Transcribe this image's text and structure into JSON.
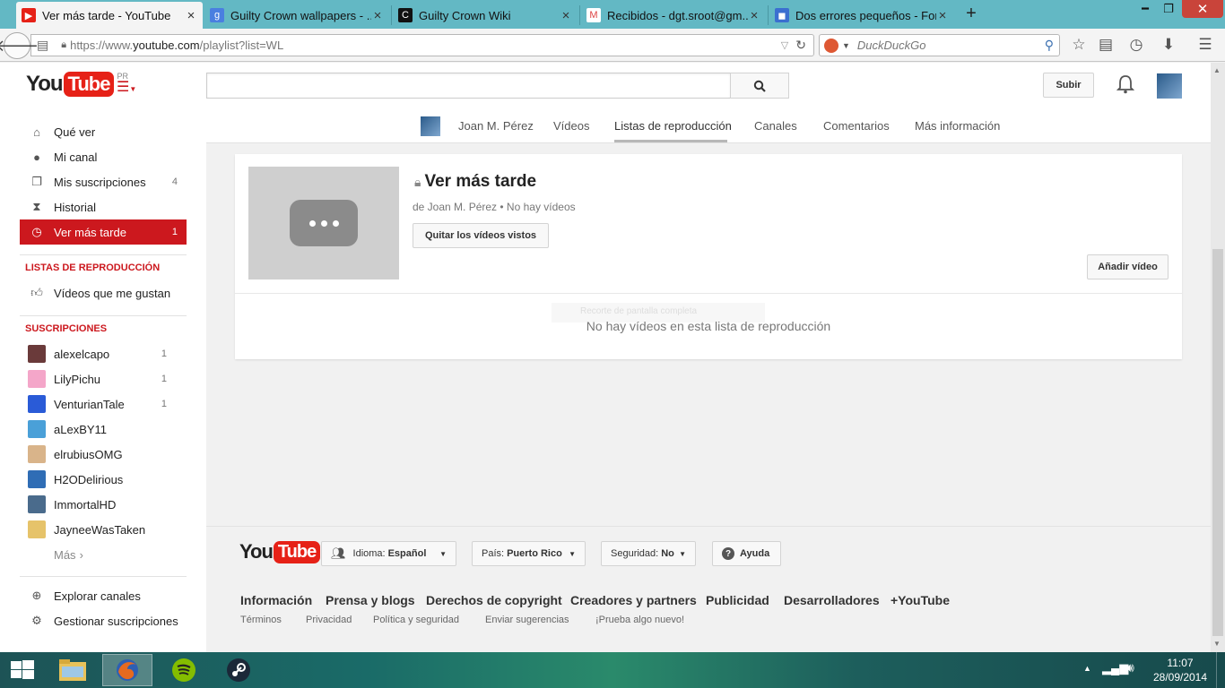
{
  "browser": {
    "tabs": [
      {
        "title": "Ver más tarde - YouTube",
        "active": true
      },
      {
        "title": "Guilty Crown wallpapers - ...",
        "active": false
      },
      {
        "title": "Guilty Crown Wiki",
        "active": false
      },
      {
        "title": "Recibidos - dgt.sroot@gm...",
        "active": false
      },
      {
        "title": "Dos errores pequeños - For...",
        "active": false
      }
    ],
    "new_tab": "+",
    "url_prefix": "https://www.",
    "url_domain": "youtube.com",
    "url_path": "/playlist?list=WL",
    "search_engine": "DuckDuckGo"
  },
  "youtube": {
    "logo_you": "You",
    "logo_tube": "Tube",
    "logo_region": "PR",
    "search_value": "",
    "upload_label": "Subir"
  },
  "sidebar": {
    "main": [
      {
        "label": "Qué ver",
        "icon": "home-icon",
        "count": ""
      },
      {
        "label": "Mi canal",
        "icon": "user-icon",
        "count": ""
      },
      {
        "label": "Mis suscripciones",
        "icon": "subscriptions-icon",
        "count": "4"
      },
      {
        "label": "Historial",
        "icon": "hourglass-icon",
        "count": ""
      },
      {
        "label": "Ver más tarde",
        "icon": "clock-icon",
        "count": "1",
        "active": true
      }
    ],
    "playlists_heading": "LISTAS DE REPRODUCCIÓN",
    "playlists": [
      {
        "label": "Vídeos que me gustan",
        "icon": "thumbs-up-icon"
      }
    ],
    "subscriptions_heading": "SUSCRIPCIONES",
    "subscriptions": [
      {
        "label": "alexelcapo",
        "count": "1",
        "color": "#6a3a3a"
      },
      {
        "label": "LilyPichu",
        "count": "1",
        "color": "#f4a6c9"
      },
      {
        "label": "VenturianTale",
        "count": "1",
        "color": "#2a5bd7"
      },
      {
        "label": "aLexBY11",
        "count": "",
        "color": "#4aa0d8"
      },
      {
        "label": "elrubiusOMG",
        "count": "",
        "color": "#d9b48a"
      },
      {
        "label": "H2ODelirious",
        "count": "",
        "color": "#2f6db5"
      },
      {
        "label": "ImmortalHD",
        "count": "",
        "color": "#4a6b8c"
      },
      {
        "label": "JayneeWasTaken",
        "count": "",
        "color": "#e6c36a"
      }
    ],
    "more_label": "Más",
    "footer_links": [
      {
        "label": "Explorar canales",
        "icon": "plus-circle-icon"
      },
      {
        "label": "Gestionar suscripciones",
        "icon": "gear-icon"
      }
    ]
  },
  "channel_nav": {
    "owner": "Joan M. Pérez",
    "tabs": [
      "Vídeos",
      "Listas de reproducción",
      "Canales",
      "Comentarios",
      "Más información"
    ],
    "selected": "Listas de reproducción"
  },
  "playlist": {
    "title": "Ver más tarde",
    "meta": "de Joan M. Pérez • No hay vídeos",
    "remove_watched_label": "Quitar los vídeos vistos",
    "add_video_label": "Añadir vídeo",
    "empty_message": "No hay vídeos en esta lista de reproducción",
    "overlay_hint": "Recorte de pantalla completa"
  },
  "footer": {
    "language_label": "Idioma:",
    "language_value": "Español",
    "country_label": "País:",
    "country_value": "Puerto Rico",
    "safety_label": "Seguridad:",
    "safety_value": "No",
    "help_label": "Ayuda",
    "links_primary": [
      "Información",
      "Prensa y blogs",
      "Derechos de copyright",
      "Creadores y partners",
      "Publicidad",
      "Desarrolladores",
      "+YouTube"
    ],
    "links_secondary": [
      "Términos",
      "Privacidad",
      "Política y seguridad",
      "Enviar sugerencias",
      "¡Prueba algo nuevo!"
    ]
  },
  "taskbar": {
    "time": "11:07",
    "date": "28/09/2014"
  },
  "colors": {
    "brand_red": "#e62117",
    "active_red": "#cc181e",
    "tab_bar": "#63b8c4"
  }
}
